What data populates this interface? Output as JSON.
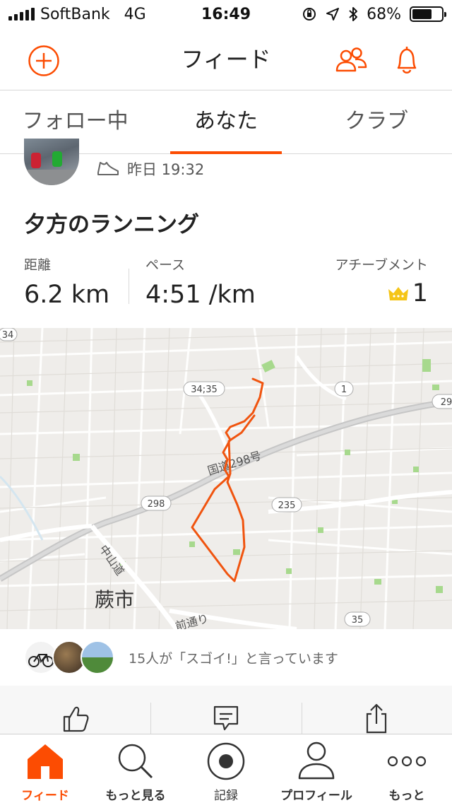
{
  "status_bar": {
    "carrier": "SoftBank",
    "network": "4G",
    "time": "16:49",
    "battery": "68%",
    "battery_level": 0.68
  },
  "header": {
    "title": "フィード",
    "add_icon": "plus-circle-icon",
    "people_icon": "people-icon",
    "bell_icon": "bell-icon"
  },
  "tabs": [
    {
      "label": "フォロー中",
      "active": false
    },
    {
      "label": "あなた",
      "active": true
    },
    {
      "label": "クラブ",
      "active": false
    }
  ],
  "activity": {
    "type_icon": "shoe-icon",
    "timestamp": "昨日 19:32",
    "title": "夕方のランニング",
    "stats": {
      "distance_label": "距離",
      "distance_value": "6.2 km",
      "pace_label": "ペース",
      "pace_value": "4:51 /km",
      "achievement_label": "アチーブメント",
      "achievement_value": "1"
    },
    "map": {
      "labels": {
        "route_34_35": "34;35",
        "route_1": "1",
        "route_29": "29",
        "route_34": "34",
        "road_298": "298",
        "road_235": "235",
        "road_35": "35",
        "kokudo": "国道298号",
        "nakasendo": "中山道",
        "city": "蕨市",
        "maemae": "前通り"
      }
    },
    "kudos_text": "15人が「スゴイ!」と言っています"
  },
  "actions": [
    {
      "icon": "thumbs-up-icon"
    },
    {
      "icon": "comment-icon"
    },
    {
      "icon": "share-icon"
    }
  ],
  "bottom_nav": [
    {
      "label": "フィード",
      "icon": "home-icon",
      "active": true
    },
    {
      "label": "もっと見る",
      "icon": "search-icon",
      "active": false
    },
    {
      "label": "記録",
      "icon": "record-icon",
      "active": false
    },
    {
      "label": "プロフィール",
      "icon": "profile-icon",
      "active": false
    },
    {
      "label": "もっと",
      "icon": "more-icon",
      "active": false
    }
  ],
  "colors": {
    "accent": "#fc4c02",
    "route": "#f0540f",
    "crown": "#f5c518"
  }
}
